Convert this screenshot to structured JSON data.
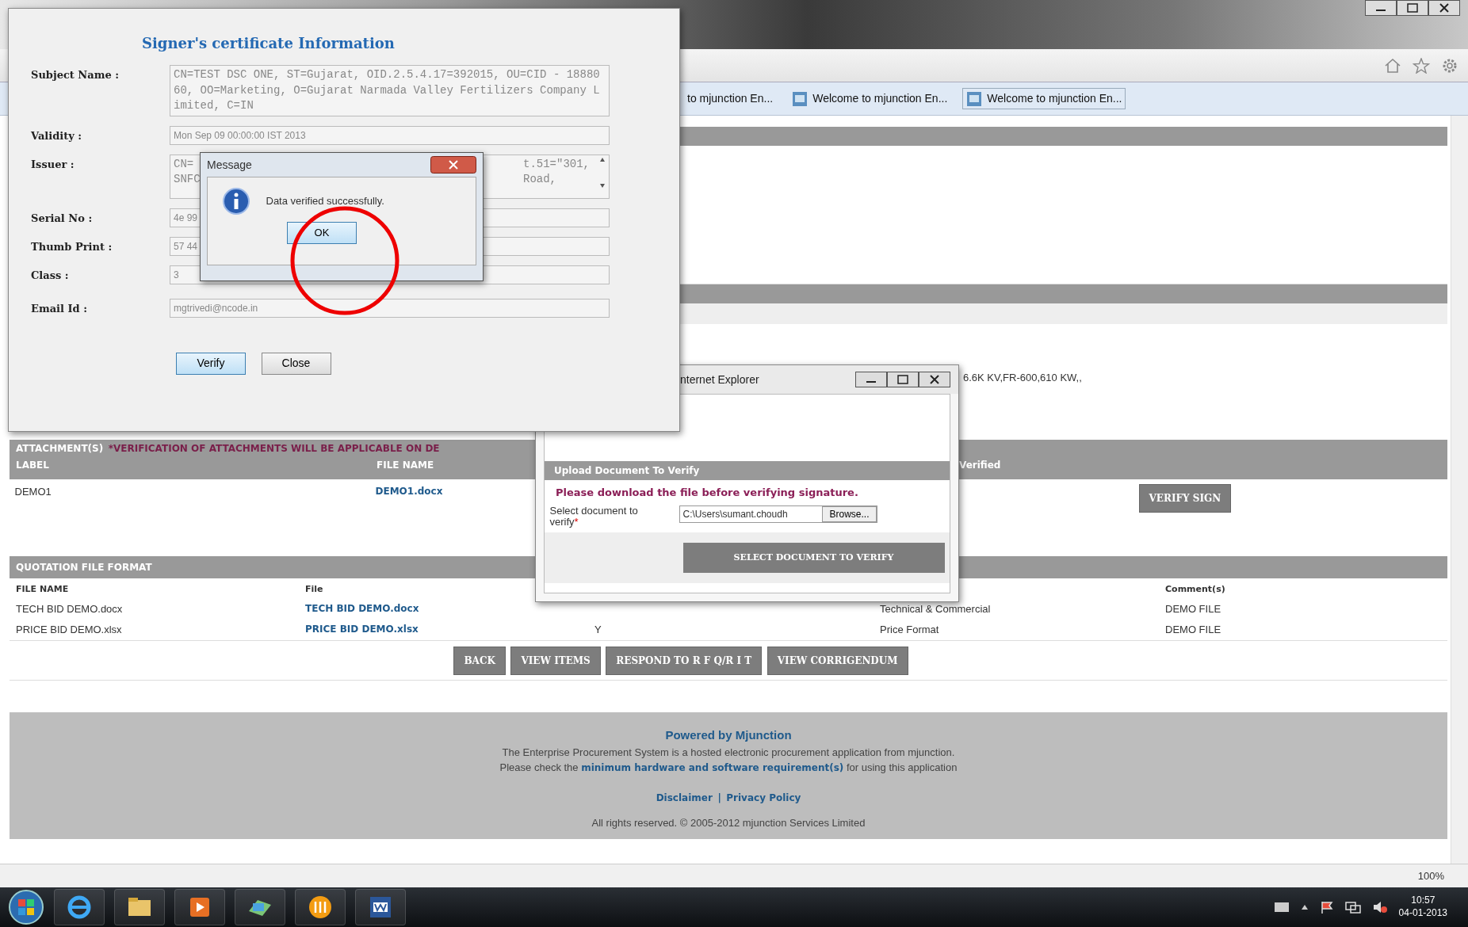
{
  "browser": {
    "tabs": [
      {
        "label": "to mjunction En...",
        "selected": false
      },
      {
        "label": "Welcome to mjunction En...",
        "selected": false
      },
      {
        "label": "Welcome to mjunction En...",
        "selected": true
      }
    ],
    "zoom": "100%"
  },
  "page": {
    "spec_text": "6.6K KV,FR-600,610 KW,,",
    "attachments": {
      "title": "ATTACHMENT(S)",
      "note": "*VERIFICATION OF ATTACHMENTS WILL BE APPLICABLE ON DE",
      "columns": [
        "LABEL",
        "FILE NAME",
        "Verified"
      ],
      "rows": [
        {
          "label": "DEMO1",
          "file": "DEMO1.docx",
          "action": "VERIFY SIGN"
        }
      ]
    },
    "quotation": {
      "title": "QUOTATION FILE FORMAT",
      "header": {
        "file_name": "FILE NAME",
        "file": "File",
        "comments": "Comment(s)"
      },
      "rows": [
        {
          "file_name": "TECH BID DEMO.docx",
          "file": "TECH BID DEMO.docx",
          "column_4": "Technical & Commercial",
          "comments": "DEMO FILE"
        },
        {
          "file_name": "PRICE BID DEMO.xlsx",
          "file": "PRICE BID DEMO.xlsx",
          "column_3": "Y",
          "column_4": "Price Format",
          "comments": "DEMO FILE"
        }
      ]
    },
    "buttons": [
      "BACK",
      "VIEW ITEMS",
      "RESPOND TO R F Q/R I T",
      "VIEW CORRIGENDUM"
    ],
    "footer": {
      "title": "Powered by Mjunction",
      "line1": "The Enterprise Procurement System is a hosted electronic procurement application from mjunction.",
      "line2_before": "Please check the",
      "line2_link": "minimum hardware and software requirement(s)",
      "line2_after": "for using this application",
      "links": [
        "Disclaimer",
        "Privacy Policy"
      ],
      "separator": "|",
      "copyright": "All rights reserved. © 2005-2012 mjunction Services Limited"
    }
  },
  "upload_dialog": {
    "title": "nternet Explorer",
    "header": "Upload Document To Verify",
    "warning": "Please download the file before verifying signature.",
    "field_label": "Select document to verify",
    "required_mark": "*",
    "file_value": "C:\\Users\\sumant.choudh",
    "browse": "Browse...",
    "submit": "SELECT DOCUMENT TO VERIFY"
  },
  "certificate_dialog": {
    "title": "Signer's certificate Information",
    "fields": [
      {
        "kind": "area",
        "label": "Subject Name :",
        "value": "CN=TEST DSC ONE, ST=Gujarat, OID.2.5.4.17=392015, OU=CID - 1888060, OO=Marketing, O=Gujarat Narmada Valley Fertilizers Company Limited, C=IN"
      },
      {
        "kind": "line",
        "label": "Validity :",
        "value": "Mon Sep 09 00:00:00 IST 2013"
      },
      {
        "kind": "split",
        "label": "Issuer :",
        "left": [
          "CN=",
          "SNFC"
        ],
        "right": [
          "t.51=\"301,",
          "Road,"
        ]
      },
      {
        "kind": "line",
        "label": "Serial No :",
        "value": "4e 99"
      },
      {
        "kind": "line",
        "label": "Thumb Print :",
        "value": "57 44"
      },
      {
        "kind": "line",
        "label": "Class :",
        "value": "3"
      },
      {
        "kind": "line",
        "label": "Email Id :",
        "value": "mgtrivedi@ncode.in"
      }
    ],
    "buttons": [
      {
        "label": "Verify",
        "selected": true
      },
      {
        "label": "Close",
        "selected": false
      }
    ]
  },
  "message_box": {
    "title": "Message",
    "text": "Data verified successfully.",
    "button": "OK"
  },
  "taskbar": {
    "time": "10:57",
    "date": "04-01-2013"
  }
}
